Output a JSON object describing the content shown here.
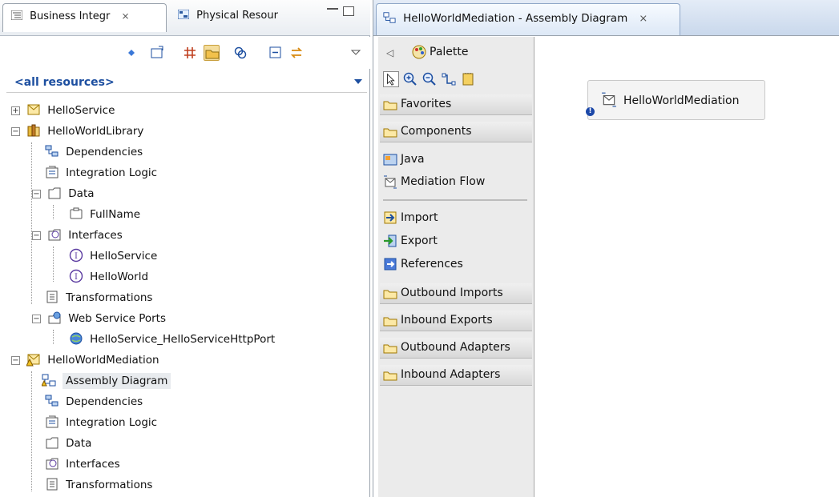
{
  "left_view": {
    "tabs": [
      {
        "label": "Business Integr",
        "close": "⨯"
      },
      {
        "label": "Physical Resour"
      }
    ],
    "filter_label": "<all resources>",
    "tree": [
      {
        "label": "HelloService"
      },
      {
        "label": "HelloWorldLibrary"
      },
      {
        "label": "Dependencies"
      },
      {
        "label": "Integration Logic"
      },
      {
        "label": "Data"
      },
      {
        "label": "FullName"
      },
      {
        "label": "Interfaces"
      },
      {
        "label": "HelloService"
      },
      {
        "label": "HelloWorld"
      },
      {
        "label": "Transformations"
      },
      {
        "label": "Web Service Ports"
      },
      {
        "label": "HelloService_HelloServiceHttpPort"
      },
      {
        "label": "HelloWorldMediation"
      },
      {
        "label": "Assembly Diagram"
      },
      {
        "label": "Dependencies"
      },
      {
        "label": "Integration Logic"
      },
      {
        "label": "Data"
      },
      {
        "label": "Interfaces"
      },
      {
        "label": "Transformations"
      }
    ],
    "twisty_expanded": "−",
    "twisty_collapsed": "+"
  },
  "editor": {
    "tab_label": "HelloWorldMediation - Assembly Diagram",
    "tab_close": "⨯",
    "palette": {
      "collapse_glyph": "◁",
      "title": "Palette",
      "drawers": {
        "favorites": "Favorites",
        "components": "Components",
        "outbound_imports": "Outbound Imports",
        "inbound_exports": "Inbound Exports",
        "outbound_adapters": "Outbound Adapters",
        "inbound_adapters": "Inbound Adapters"
      },
      "entries": {
        "java": "Java",
        "mediation_flow": "Mediation Flow",
        "import": "Import",
        "export": "Export",
        "references": "References"
      }
    },
    "canvas": {
      "component_label": "HelloWorldMediation",
      "error_marker": "!"
    }
  },
  "colors": {
    "accent_blue": "#1d4fa0",
    "selected_toolbar": "#f4dd9c"
  }
}
